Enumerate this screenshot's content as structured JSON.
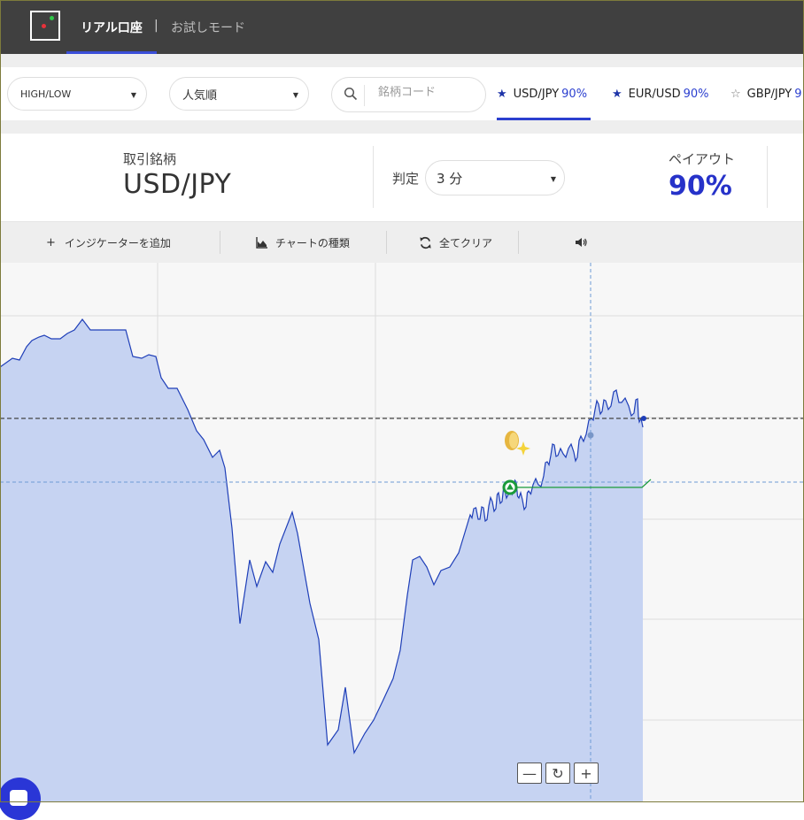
{
  "header": {
    "tab_real": "リアル口座",
    "separator": "|",
    "tab_demo": "お試しモード"
  },
  "filters": {
    "trade_type": "HIGH/LOW",
    "sort": "人気順",
    "search_placeholder": "銘柄コード",
    "favorites": [
      {
        "name": "USD/JPY",
        "payout": "90%"
      },
      {
        "name": "EUR/USD",
        "payout": "90%"
      },
      {
        "name": "GBP/JPY",
        "payout": "9"
      }
    ]
  },
  "instrument": {
    "label": "取引銘柄",
    "value": "USD/JPY",
    "judge_label": "判定",
    "judge_value": "3 分",
    "payout_label": "ペイアウト",
    "payout_value": "90%"
  },
  "toolbar": {
    "add_indicator": "インジケーターを追加",
    "chart_type": "チャートの種類",
    "clear_all": "全てクリア"
  },
  "chart": {
    "line_color": "#1f3fb8",
    "fill_color": "#c6d3f2",
    "entry_color": "#1a9a3a",
    "zoom_out": "—",
    "zoom_reset": "↻",
    "zoom_in": "+"
  }
}
